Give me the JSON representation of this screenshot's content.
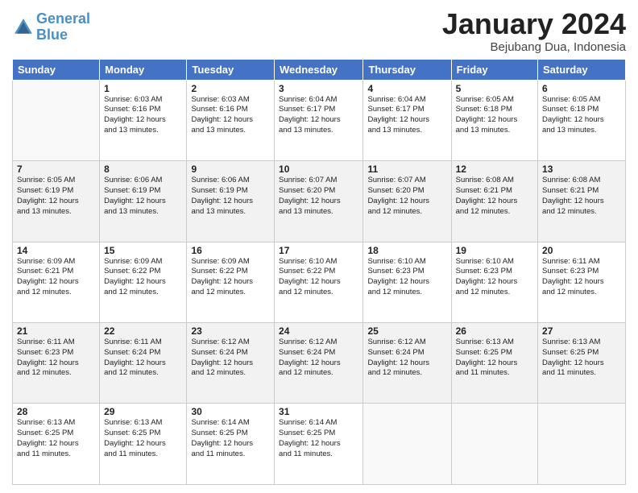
{
  "header": {
    "logo_line1": "General",
    "logo_line2": "Blue",
    "month": "January 2024",
    "location": "Bejubang Dua, Indonesia"
  },
  "days_of_week": [
    "Sunday",
    "Monday",
    "Tuesday",
    "Wednesday",
    "Thursday",
    "Friday",
    "Saturday"
  ],
  "weeks": [
    [
      {
        "num": "",
        "info": ""
      },
      {
        "num": "1",
        "info": "Sunrise: 6:03 AM\nSunset: 6:16 PM\nDaylight: 12 hours\nand 13 minutes."
      },
      {
        "num": "2",
        "info": "Sunrise: 6:03 AM\nSunset: 6:16 PM\nDaylight: 12 hours\nand 13 minutes."
      },
      {
        "num": "3",
        "info": "Sunrise: 6:04 AM\nSunset: 6:17 PM\nDaylight: 12 hours\nand 13 minutes."
      },
      {
        "num": "4",
        "info": "Sunrise: 6:04 AM\nSunset: 6:17 PM\nDaylight: 12 hours\nand 13 minutes."
      },
      {
        "num": "5",
        "info": "Sunrise: 6:05 AM\nSunset: 6:18 PM\nDaylight: 12 hours\nand 13 minutes."
      },
      {
        "num": "6",
        "info": "Sunrise: 6:05 AM\nSunset: 6:18 PM\nDaylight: 12 hours\nand 13 minutes."
      }
    ],
    [
      {
        "num": "7",
        "info": "Sunrise: 6:05 AM\nSunset: 6:19 PM\nDaylight: 12 hours\nand 13 minutes."
      },
      {
        "num": "8",
        "info": "Sunrise: 6:06 AM\nSunset: 6:19 PM\nDaylight: 12 hours\nand 13 minutes."
      },
      {
        "num": "9",
        "info": "Sunrise: 6:06 AM\nSunset: 6:19 PM\nDaylight: 12 hours\nand 13 minutes."
      },
      {
        "num": "10",
        "info": "Sunrise: 6:07 AM\nSunset: 6:20 PM\nDaylight: 12 hours\nand 13 minutes."
      },
      {
        "num": "11",
        "info": "Sunrise: 6:07 AM\nSunset: 6:20 PM\nDaylight: 12 hours\nand 12 minutes."
      },
      {
        "num": "12",
        "info": "Sunrise: 6:08 AM\nSunset: 6:21 PM\nDaylight: 12 hours\nand 12 minutes."
      },
      {
        "num": "13",
        "info": "Sunrise: 6:08 AM\nSunset: 6:21 PM\nDaylight: 12 hours\nand 12 minutes."
      }
    ],
    [
      {
        "num": "14",
        "info": "Sunrise: 6:09 AM\nSunset: 6:21 PM\nDaylight: 12 hours\nand 12 minutes."
      },
      {
        "num": "15",
        "info": "Sunrise: 6:09 AM\nSunset: 6:22 PM\nDaylight: 12 hours\nand 12 minutes."
      },
      {
        "num": "16",
        "info": "Sunrise: 6:09 AM\nSunset: 6:22 PM\nDaylight: 12 hours\nand 12 minutes."
      },
      {
        "num": "17",
        "info": "Sunrise: 6:10 AM\nSunset: 6:22 PM\nDaylight: 12 hours\nand 12 minutes."
      },
      {
        "num": "18",
        "info": "Sunrise: 6:10 AM\nSunset: 6:23 PM\nDaylight: 12 hours\nand 12 minutes."
      },
      {
        "num": "19",
        "info": "Sunrise: 6:10 AM\nSunset: 6:23 PM\nDaylight: 12 hours\nand 12 minutes."
      },
      {
        "num": "20",
        "info": "Sunrise: 6:11 AM\nSunset: 6:23 PM\nDaylight: 12 hours\nand 12 minutes."
      }
    ],
    [
      {
        "num": "21",
        "info": "Sunrise: 6:11 AM\nSunset: 6:23 PM\nDaylight: 12 hours\nand 12 minutes."
      },
      {
        "num": "22",
        "info": "Sunrise: 6:11 AM\nSunset: 6:24 PM\nDaylight: 12 hours\nand 12 minutes."
      },
      {
        "num": "23",
        "info": "Sunrise: 6:12 AM\nSunset: 6:24 PM\nDaylight: 12 hours\nand 12 minutes."
      },
      {
        "num": "24",
        "info": "Sunrise: 6:12 AM\nSunset: 6:24 PM\nDaylight: 12 hours\nand 12 minutes."
      },
      {
        "num": "25",
        "info": "Sunrise: 6:12 AM\nSunset: 6:24 PM\nDaylight: 12 hours\nand 12 minutes."
      },
      {
        "num": "26",
        "info": "Sunrise: 6:13 AM\nSunset: 6:25 PM\nDaylight: 12 hours\nand 11 minutes."
      },
      {
        "num": "27",
        "info": "Sunrise: 6:13 AM\nSunset: 6:25 PM\nDaylight: 12 hours\nand 11 minutes."
      }
    ],
    [
      {
        "num": "28",
        "info": "Sunrise: 6:13 AM\nSunset: 6:25 PM\nDaylight: 12 hours\nand 11 minutes."
      },
      {
        "num": "29",
        "info": "Sunrise: 6:13 AM\nSunset: 6:25 PM\nDaylight: 12 hours\nand 11 minutes."
      },
      {
        "num": "30",
        "info": "Sunrise: 6:14 AM\nSunset: 6:25 PM\nDaylight: 12 hours\nand 11 minutes."
      },
      {
        "num": "31",
        "info": "Sunrise: 6:14 AM\nSunset: 6:25 PM\nDaylight: 12 hours\nand 11 minutes."
      },
      {
        "num": "",
        "info": ""
      },
      {
        "num": "",
        "info": ""
      },
      {
        "num": "",
        "info": ""
      }
    ]
  ]
}
